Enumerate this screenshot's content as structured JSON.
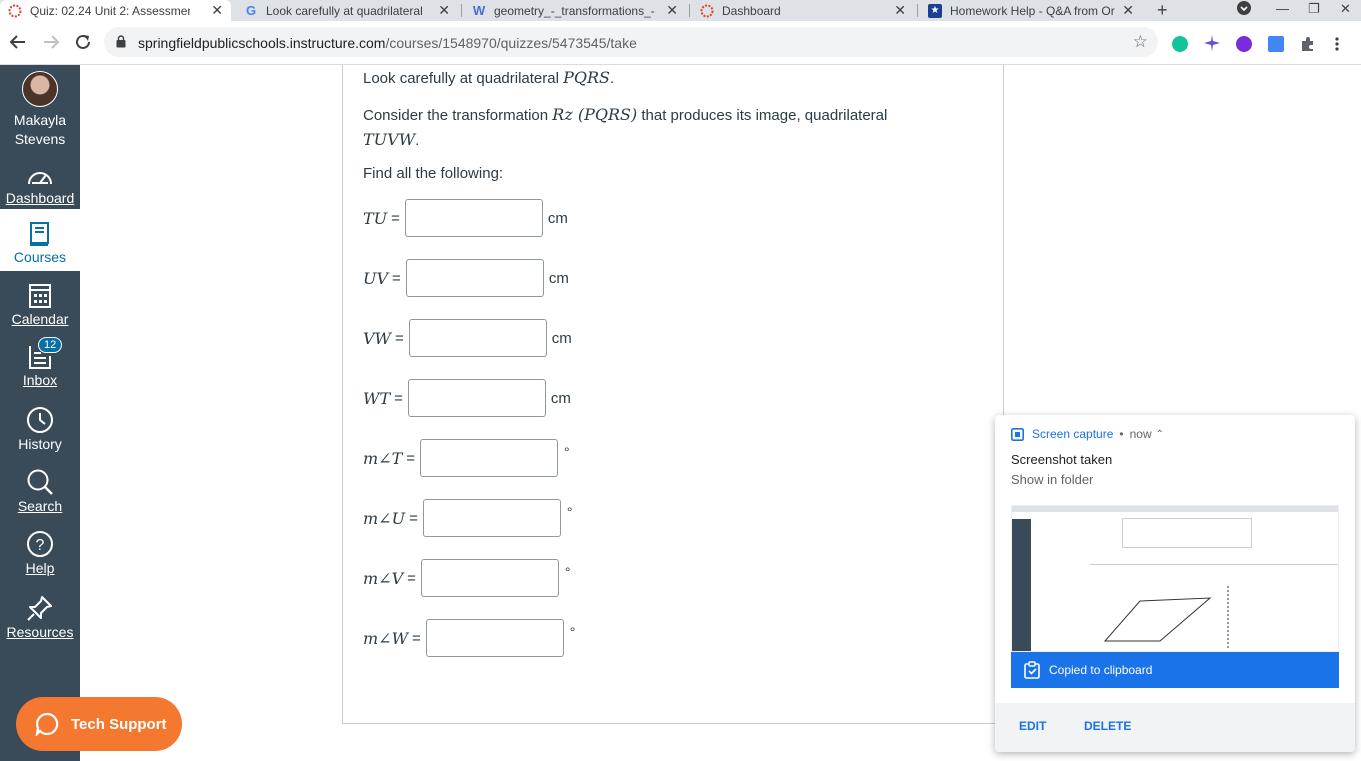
{
  "browser": {
    "tabs": [
      {
        "label": "Quiz: 02.24 Unit 2: Assessmen",
        "icon": "canvas-icon",
        "active": true
      },
      {
        "label": "Look carefully at quadrilateral",
        "icon": "google-icon",
        "active": false
      },
      {
        "label": "geometry_-_transformations_-",
        "icon": "wolfram-icon",
        "active": false
      },
      {
        "label": "Dashboard",
        "icon": "canvas-icon",
        "active": false
      },
      {
        "label": "Homework Help - Q&A from Or",
        "icon": "star-icon",
        "active": false
      }
    ],
    "url_host": "springfieldpublicschools.instructure.com",
    "url_path": "/courses/1548970/quizzes/5473545/take"
  },
  "sidebar": {
    "user_name": "Makayla Stevens",
    "items": [
      {
        "label": "Dashboard",
        "icon": "dashboard-icon"
      },
      {
        "label": "Courses",
        "icon": "courses-icon"
      },
      {
        "label": "Calendar",
        "icon": "calendar-icon"
      },
      {
        "label": "Inbox",
        "icon": "inbox-icon",
        "badge": "12"
      },
      {
        "label": "History",
        "icon": "clock-icon"
      },
      {
        "label": "Search",
        "icon": "search-icon"
      },
      {
        "label": "Help",
        "icon": "help-icon"
      },
      {
        "label": "Resources",
        "icon": "pin-icon"
      }
    ],
    "tech_support": "Tech Support"
  },
  "question": {
    "line1_prefix": "Look carefully at quadrilateral",
    "line1_math": "PQRS",
    "line2_prefix": "Consider the transformation",
    "line2_math": "Rz (PQRS)",
    "line2_suffix": "that produces its image, quadrilateral",
    "line3_math": "TUVW",
    "prompt": "Find all the following:",
    "fields": [
      {
        "label": "TU",
        "value": "",
        "unit": "cm"
      },
      {
        "label": "UV",
        "value": "",
        "unit": "cm"
      },
      {
        "label": "VW",
        "value": "",
        "unit": "cm"
      },
      {
        "label": "WT",
        "value": "",
        "unit": "cm"
      },
      {
        "label": "m∠T",
        "value": "",
        "unit": "°"
      },
      {
        "label": "m∠U",
        "value": "",
        "unit": "°"
      },
      {
        "label": "m∠V",
        "value": "",
        "unit": "°"
      },
      {
        "label": "m∠W",
        "value": "",
        "unit": "°"
      }
    ]
  },
  "notification": {
    "source": "Screen capture",
    "time": "now",
    "title": "Screenshot taken",
    "message": "Show in folder",
    "copied": "Copied to clipboard",
    "edit": "EDIT",
    "delete": "DELETE"
  },
  "colors": {
    "sidebar_bg": "#394b58",
    "canvas_blue": "#0770a3",
    "tech_support_orange": "#f4782f",
    "notif_blue": "#1a73e8"
  }
}
